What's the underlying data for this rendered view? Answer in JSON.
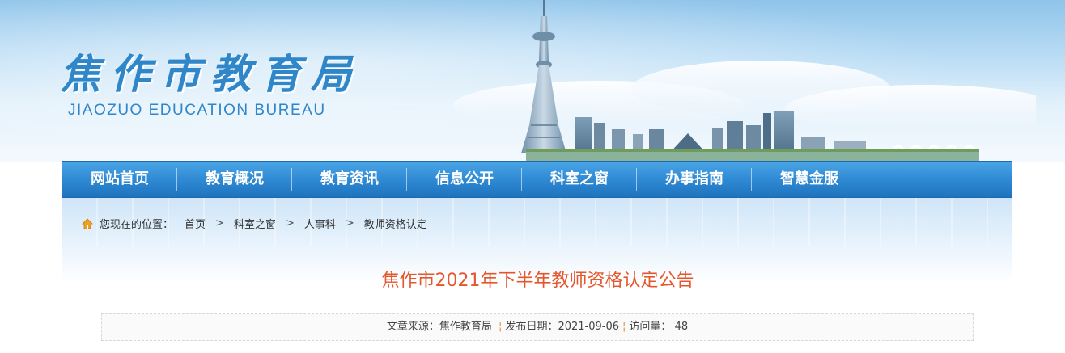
{
  "header": {
    "logo_cn": "焦作市教育局",
    "logo_en": "JIAOZUO EDUCATION BUREAU"
  },
  "nav": {
    "items": [
      {
        "label": "网站首页"
      },
      {
        "label": "教育概况"
      },
      {
        "label": "教育资讯"
      },
      {
        "label": "信息公开"
      },
      {
        "label": "科室之窗"
      },
      {
        "label": "办事指南"
      },
      {
        "label": "智慧金服"
      }
    ]
  },
  "breadcrumb": {
    "prefix": "您现在的位置：",
    "items": [
      "首页",
      "科室之窗",
      "人事科",
      "教师资格认定"
    ],
    "separator": ">",
    "home_icon": "home-icon"
  },
  "article": {
    "title": "焦作市2021年下半年教师资格认定公告",
    "source_label": "文章来源：",
    "source": "焦作教育局",
    "date_label": "发布日期：",
    "date": "2021-09-06",
    "views_label": "访问量：",
    "views": "48",
    "divider": "¦"
  },
  "colors": {
    "nav_bg": "#2f8ad4",
    "title": "#e4572e",
    "logo": "#2f86c8"
  }
}
